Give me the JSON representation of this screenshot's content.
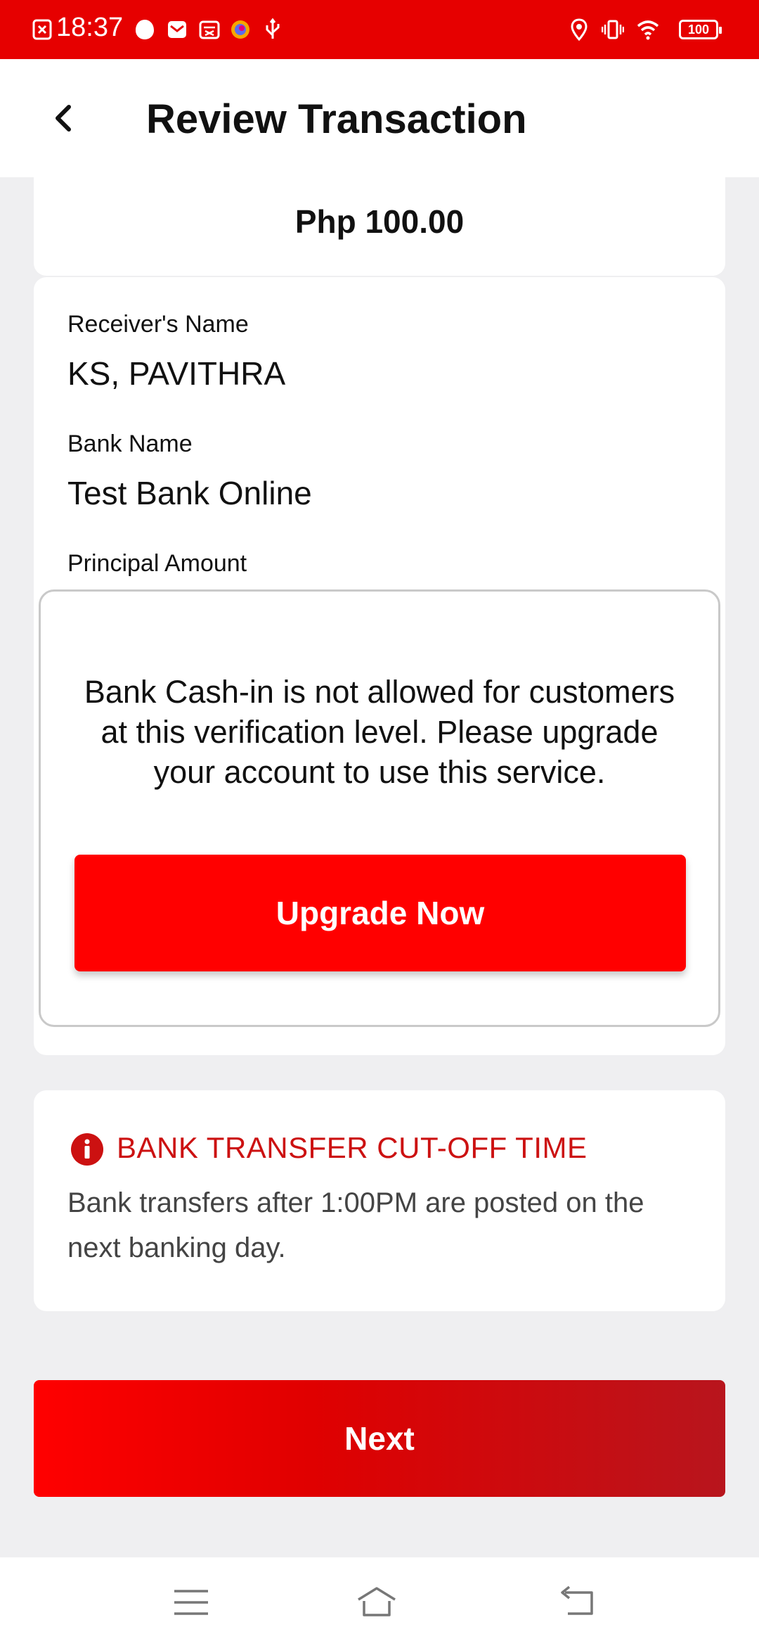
{
  "status_bar": {
    "time": "18:37",
    "battery": "100",
    "icons": [
      "screenshot-icon",
      "app-icon",
      "mail-icon",
      "calendar-icon",
      "browser-icon",
      "usb-icon",
      "location-icon",
      "vibrate-icon",
      "wifi-icon",
      "battery-icon"
    ]
  },
  "header": {
    "title": "Review Transaction",
    "back_icon": "chevron-left-icon"
  },
  "amount": "Php 100.00",
  "details": {
    "receiver_label": "Receiver's Name",
    "receiver_value": "KS, PAVITHRA",
    "bank_label": "Bank Name",
    "bank_value": "Test Bank Online",
    "principal_label": "Principal Amount"
  },
  "dialog": {
    "message": "Bank Cash-in is not allowed for customers at this verification level. Please upgrade your account to use this service.",
    "button_label": "Upgrade Now"
  },
  "cutoff": {
    "title": "BANK TRANSFER CUT-OFF TIME",
    "text": "Bank transfers after 1:00PM are posted on the next banking day."
  },
  "next_button": "Next",
  "colors": {
    "brand_red": "#e60000",
    "button_red": "#ff0000",
    "cutoff_title": "#cc1111"
  }
}
